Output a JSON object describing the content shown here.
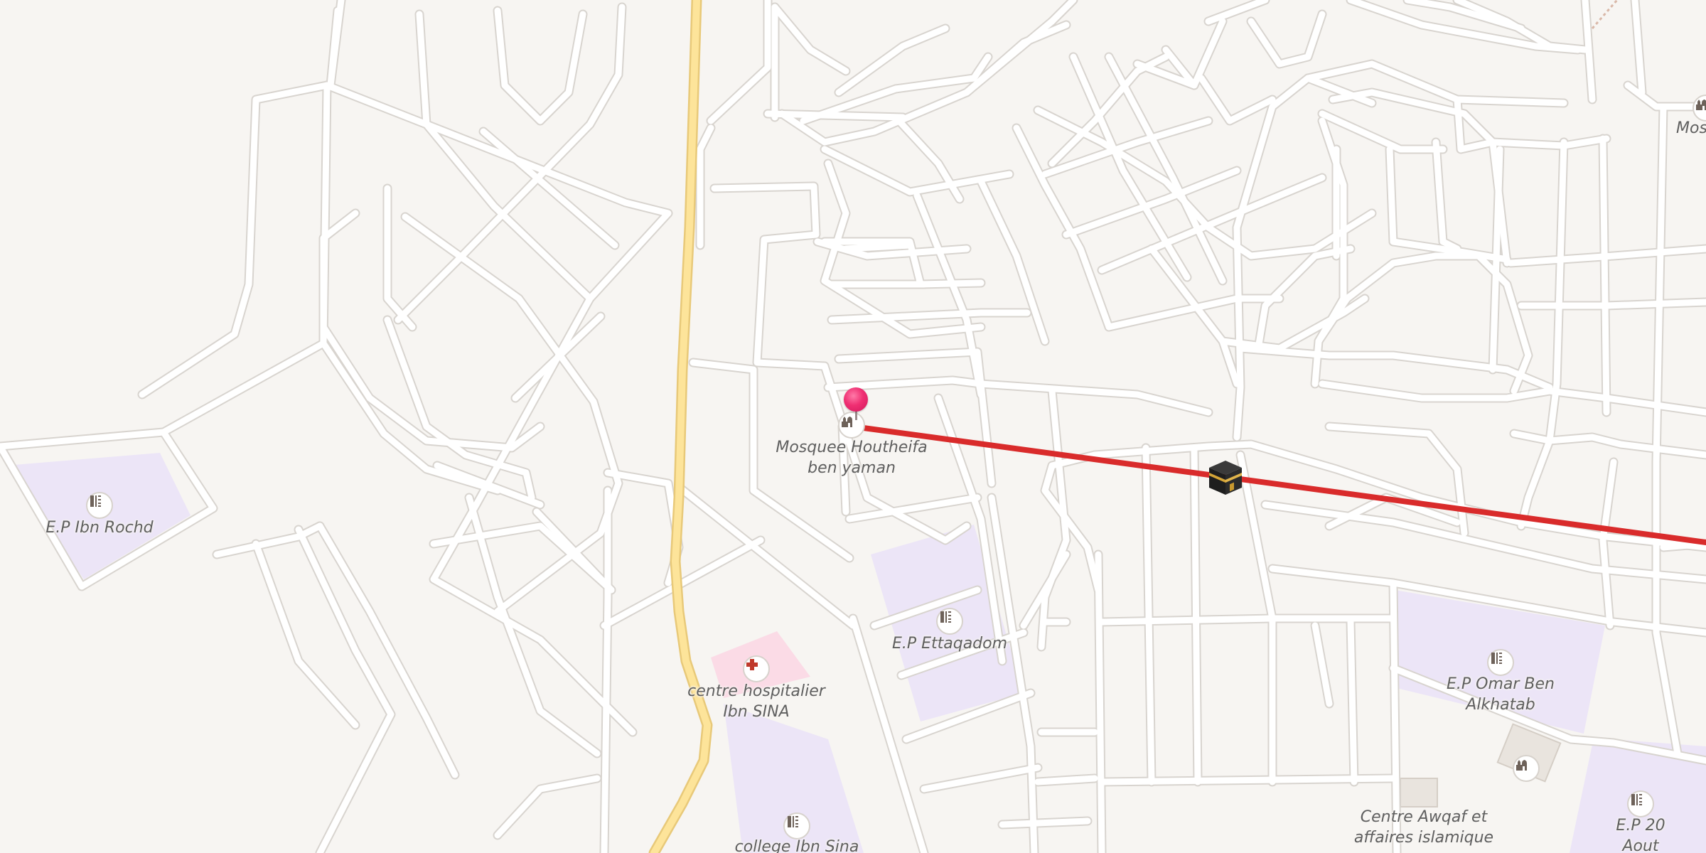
{
  "map": {
    "background_color": "#f7f5f2",
    "road_color": "#ffffff",
    "road_casing_color": "#d8d4cf",
    "main_road_color": "#fde49a",
    "main_road_casing_color": "#e8c979",
    "school_area_color": "#ece5f7",
    "hospital_area_color": "#fbdbe6",
    "qibla_line_color": "#d92b2b"
  },
  "markers": {
    "selected_pin": {
      "icon": "map-pin-icon",
      "color": "#ef2f72"
    },
    "kaaba": {
      "icon": "kaaba-icon"
    }
  },
  "pois": {
    "mosquee_houtheifa": {
      "label": "Mosquee Houtheifa\nben yaman",
      "icon": "mosque-icon"
    },
    "ep_ibn_rochd": {
      "label": "E.P Ibn Rochd",
      "icon": "school-icon"
    },
    "ep_ettaqadom": {
      "label": "E.P Ettaqadom",
      "icon": "school-icon"
    },
    "centre_hospitalier": {
      "label": "centre hospitalier\nIbn SINA",
      "icon": "hospital-icon"
    },
    "college_ibn_sina": {
      "label": "college Ibn Sina",
      "icon": "school-icon"
    },
    "ep_omar": {
      "label": "E.P Omar Ben\nAlkhatab",
      "icon": "school-icon"
    },
    "centre_awqaf": {
      "label": "Centre Awqaf et\naffaires islamique",
      "icon": "mosque-icon"
    },
    "ep_20_aout": {
      "label": "E.P 20 Aout",
      "icon": "school-icon"
    },
    "mosque_partial": {
      "label": "Mosqu",
      "icon": "mosque-icon"
    }
  }
}
